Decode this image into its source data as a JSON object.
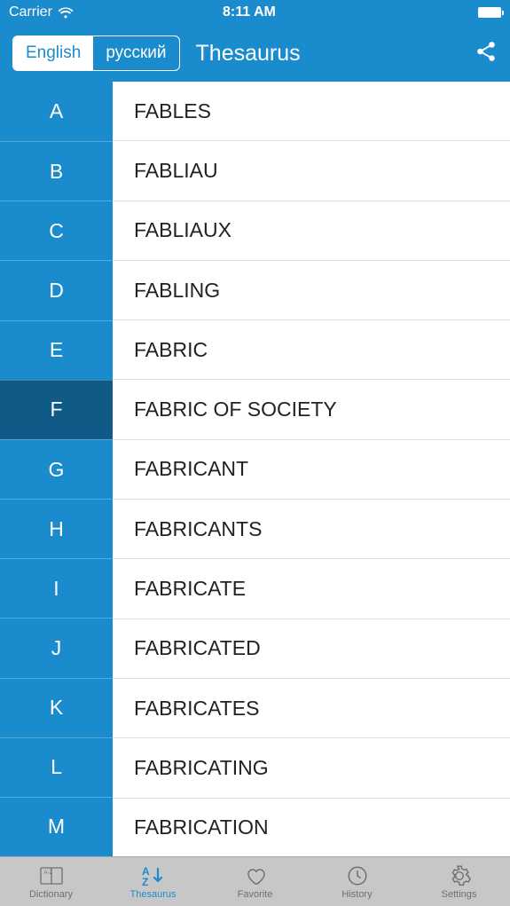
{
  "status": {
    "carrier": "Carrier",
    "time": "8:11 AM"
  },
  "nav": {
    "lang1": "English",
    "lang2": "русский",
    "title": "Thesaurus"
  },
  "index": {
    "letters": [
      "A",
      "B",
      "C",
      "D",
      "E",
      "F",
      "G",
      "H",
      "I",
      "J",
      "K",
      "L",
      "M"
    ],
    "selected": "F"
  },
  "words": [
    "FABLES",
    "FABLIAU",
    "FABLIAUX",
    "FABLING",
    "FABRIC",
    "FABRIC OF SOCIETY",
    "FABRICANT",
    "FABRICANTS",
    "FABRICATE",
    "FABRICATED",
    "FABRICATES",
    "FABRICATING",
    "FABRICATION"
  ],
  "tabs": {
    "dictionary": "Dictionary",
    "thesaurus": "Thesaurus",
    "favorite": "Favorite",
    "history": "History",
    "settings": "Settings",
    "active": "thesaurus"
  }
}
